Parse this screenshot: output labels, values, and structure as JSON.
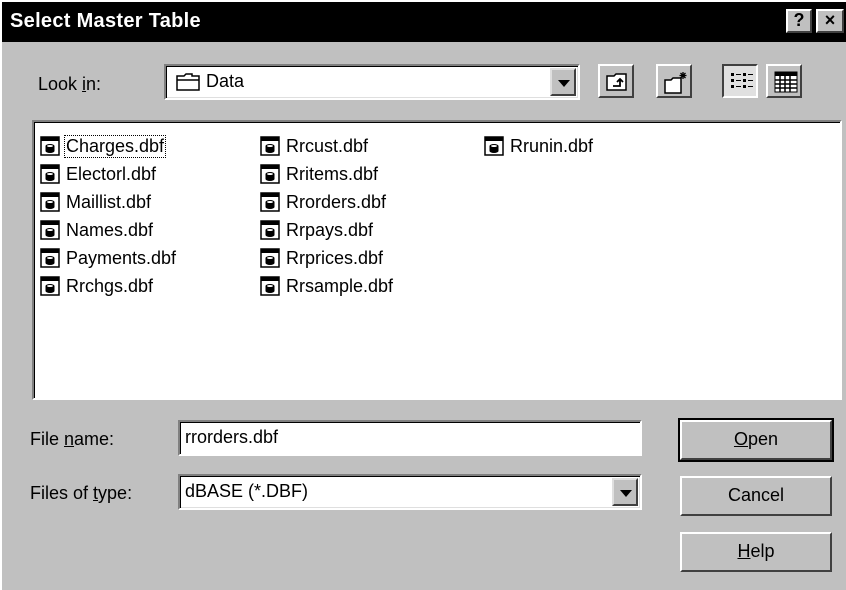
{
  "window": {
    "title": "Select Master Table",
    "help_label": "?",
    "close_label": "×"
  },
  "look_in": {
    "label_pre": "Look ",
    "label_accel": "i",
    "label_post": "n:",
    "value": "Data"
  },
  "files": {
    "columns": [
      [
        "Charges.dbf",
        "Electorl.dbf",
        "Maillist.dbf",
        "Names.dbf",
        "Payments.dbf",
        "Rrchgs.dbf"
      ],
      [
        "Rrcust.dbf",
        "Rritems.dbf",
        "Rrorders.dbf",
        "Rrpays.dbf",
        "Rrprices.dbf",
        "Rrsample.dbf"
      ],
      [
        "Rrunin.dbf"
      ]
    ],
    "focused": "Charges.dbf"
  },
  "file_name": {
    "label_pre": "File ",
    "label_accel": "n",
    "label_post": "ame:",
    "value": "rrorders.dbf"
  },
  "file_type": {
    "label_pre": "Files of ",
    "label_accel": "t",
    "label_post": "ype:",
    "value": "dBASE (*.DBF)"
  },
  "buttons": {
    "open_accel": "O",
    "open_rest": "pen",
    "cancel": "Cancel",
    "help_accel": "H",
    "help_rest": "elp"
  },
  "icons": {
    "folder": "folder-icon",
    "up": "up-one-level-icon",
    "new_folder": "new-folder-icon",
    "list_view": "list-view-icon",
    "details_view": "details-view-icon",
    "file": "database-file-icon"
  }
}
